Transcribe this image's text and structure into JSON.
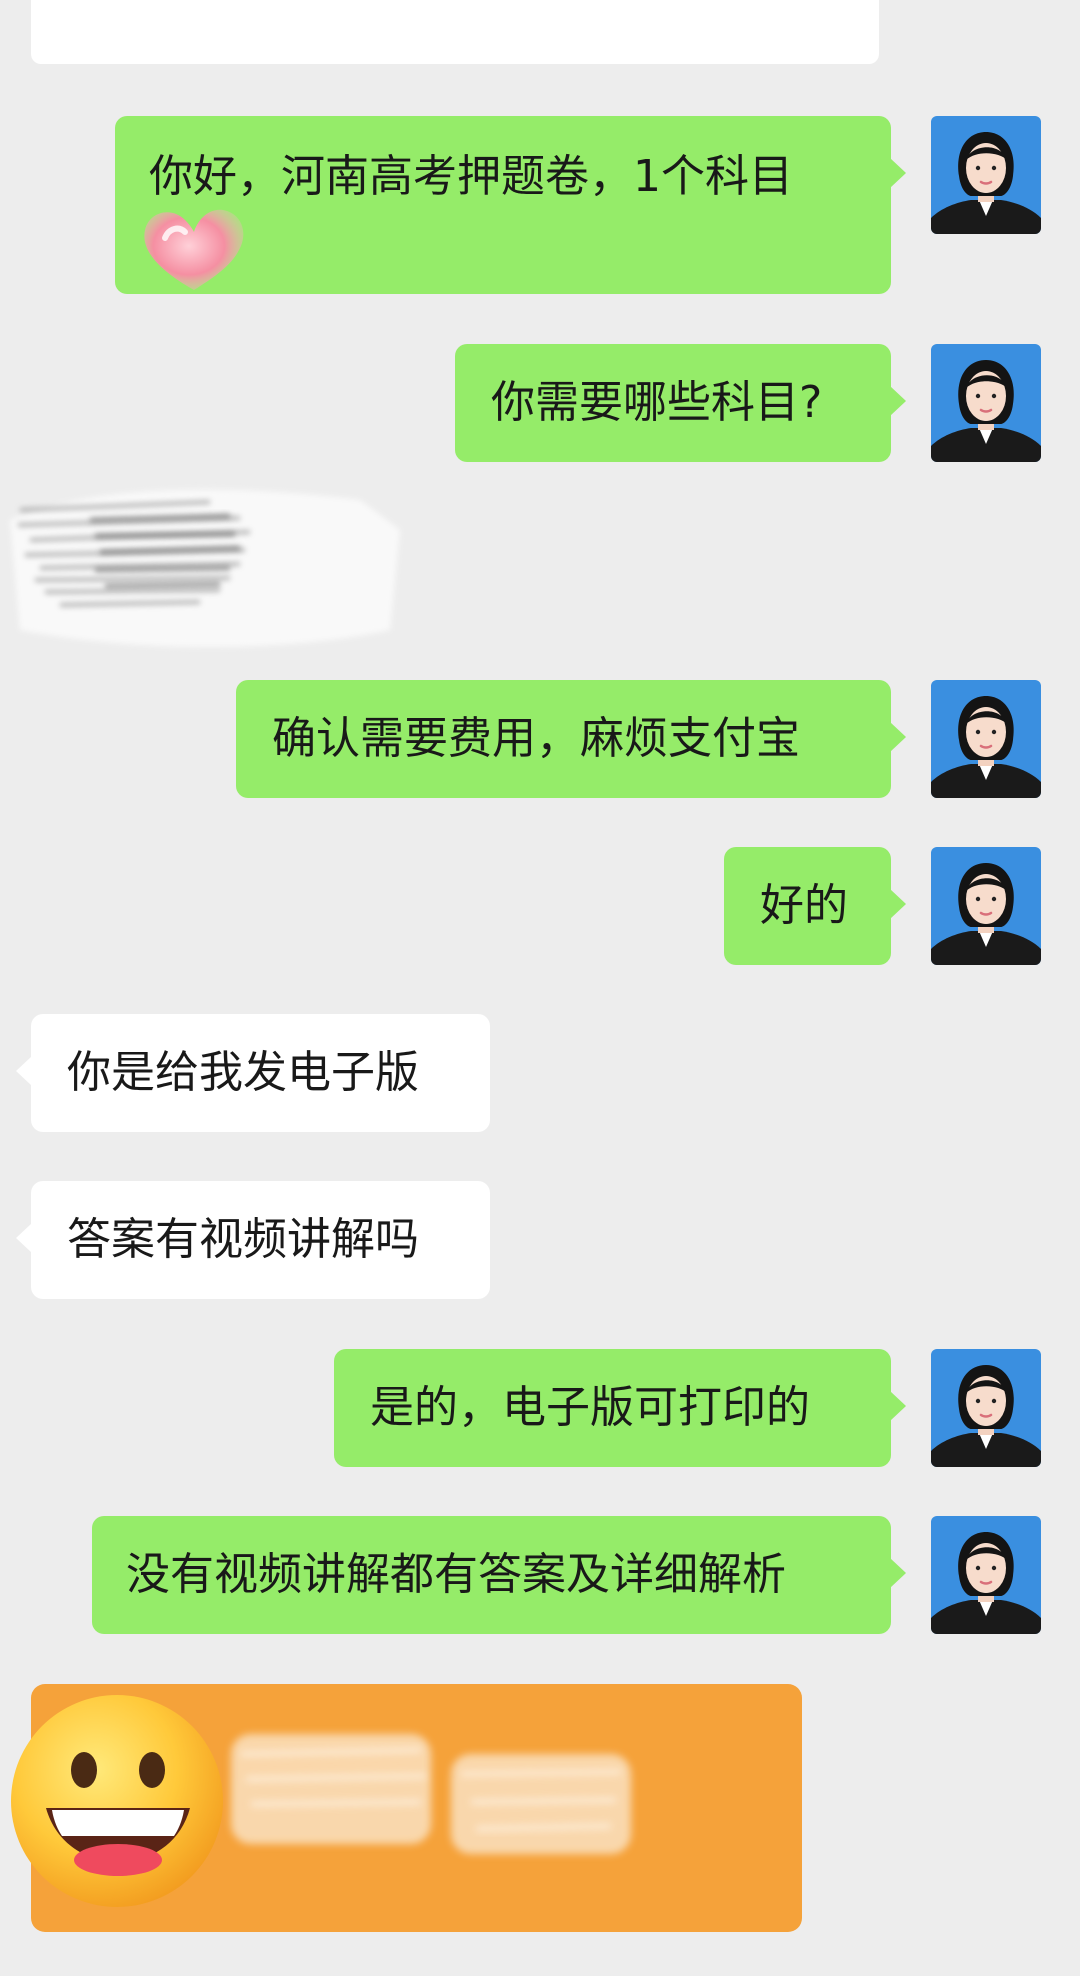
{
  "messages": [
    {
      "side": "out",
      "text": "你好，河南高考押题卷，1个科目"
    },
    {
      "side": "out",
      "text": "你需要哪些科目?"
    },
    {
      "side": "out",
      "text": "确认需要费用，麻烦支付宝"
    },
    {
      "side": "out",
      "text": "好的"
    },
    {
      "side": "in",
      "text": "你是给我发电子版"
    },
    {
      "side": "in",
      "text": "答案有视频讲解吗"
    },
    {
      "side": "out",
      "text": "是的，电子版可打印的"
    },
    {
      "side": "out",
      "text": "没有视频讲解都有答案及详细解析"
    }
  ],
  "colors": {
    "background": "#ededed",
    "outgoing_bubble": "#95ec69",
    "incoming_bubble": "#ffffff",
    "text": "#191919",
    "orange_card": "#f5a23a",
    "avatar_bg": "#3a8fe0"
  },
  "icons": {
    "avatar": "woman-portrait-avatar-icon",
    "sticker_heart": "heart-sticker-icon",
    "sticker_smile": "grinning-face-emoji-icon",
    "redaction": "scribble-redaction-icon"
  }
}
